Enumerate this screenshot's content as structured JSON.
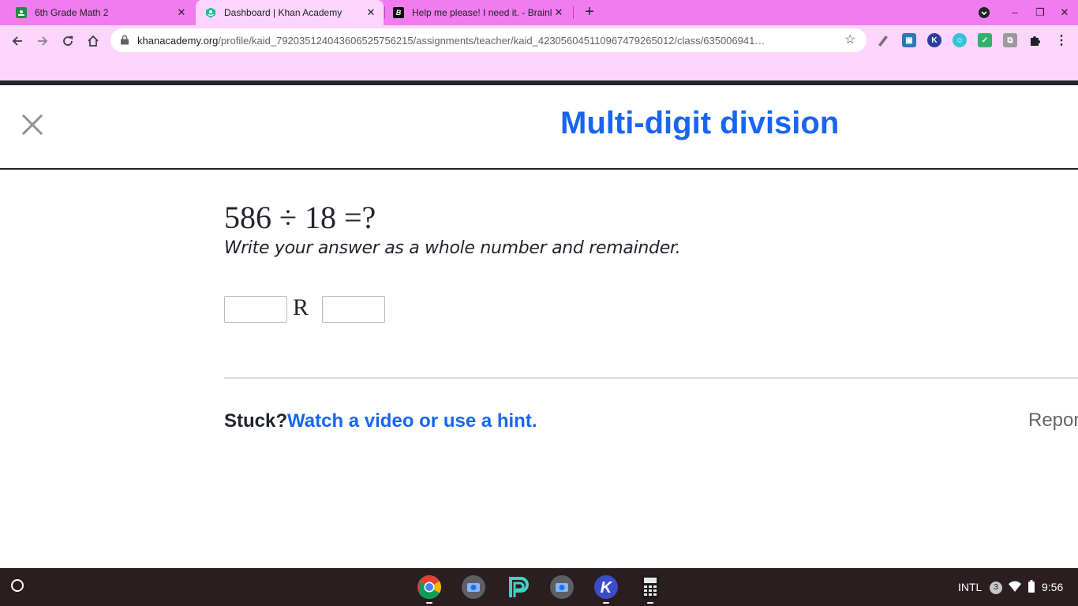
{
  "browser": {
    "tabs": [
      {
        "title": "6th Grade Math 2",
        "favicon": "google-classroom-icon",
        "active": false
      },
      {
        "title": "Dashboard | Khan Academy",
        "favicon": "khan-academy-icon",
        "active": true
      },
      {
        "title": "Help me please! I need it. - Brainl",
        "favicon": "brainly-icon",
        "active": false
      }
    ],
    "url_host": "khanacademy.org",
    "url_path": "/profile/kaid_792035124043606525756215/assignments/teacher/kaid_423056045110967479265012/class/635006941…",
    "accent_color": "#f07cf0",
    "active_tab_color": "#fcd5fc"
  },
  "exercise": {
    "title": "Multi-digit division",
    "question": "586 ÷ 18 =?",
    "instruction": "Write your answer as a whole number and remainder.",
    "remainder_label": "R",
    "quotient_value": "",
    "remainder_value": "",
    "stuck_label": "Stuck?",
    "hint_link": "Watch a video or use a hint.",
    "report_label": "Repor",
    "title_color": "#1865f2"
  },
  "shelf": {
    "apps": [
      "chrome-icon",
      "camera-icon",
      "pear-deck-icon",
      "camera-icon",
      "kahoot-icon",
      "calculator-icon"
    ],
    "input_method": "INTL",
    "notification_count": "3",
    "time": "9:56"
  }
}
